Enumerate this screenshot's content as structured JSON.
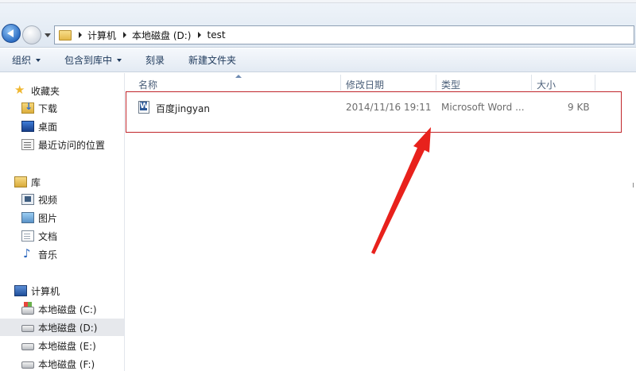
{
  "address_bar": {
    "crumbs": [
      "计算机",
      "本地磁盘 (D:)",
      "test"
    ]
  },
  "toolbar": {
    "organize": "组织",
    "include_in_library": "包含到库中",
    "burn": "刻录",
    "new_folder": "新建文件夹"
  },
  "sidebar": {
    "favorites": {
      "label": "收藏夹",
      "items": [
        "下载",
        "桌面",
        "最近访问的位置"
      ]
    },
    "libraries": {
      "label": "库",
      "items": [
        "视频",
        "图片",
        "文档",
        "音乐"
      ]
    },
    "computer": {
      "label": "计算机",
      "drives": [
        "本地磁盘 (C:)",
        "本地磁盘 (D:)",
        "本地磁盘 (E:)",
        "本地磁盘 (F:)"
      ],
      "selected_drive": "本地磁盘 (D:)"
    }
  },
  "columns": {
    "name": "名称",
    "modified": "修改日期",
    "type": "类型",
    "size": "大小"
  },
  "files": [
    {
      "name": "百度jingyan",
      "modified": "2014/11/16 19:11",
      "type": "Microsoft Word ...",
      "size": "9 KB",
      "icon": "word-doc-icon"
    }
  ],
  "annotation": {
    "highlight_color": "#c0262b",
    "arrow_color": "#e8211c"
  }
}
